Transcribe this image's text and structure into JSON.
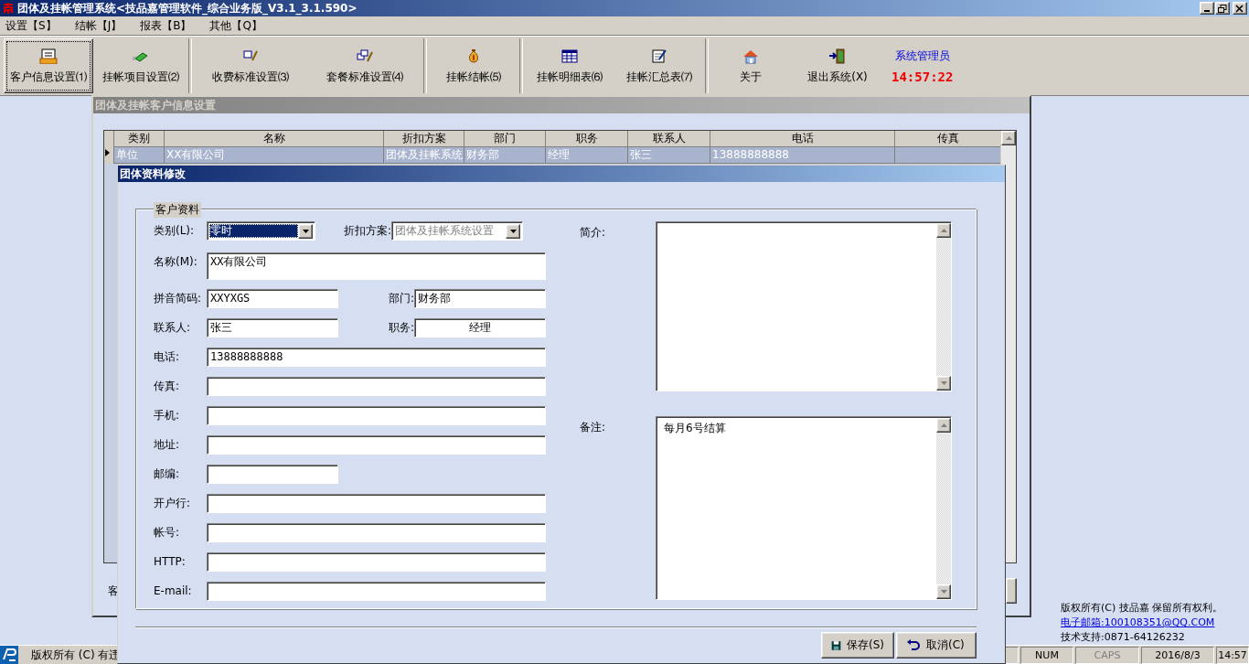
{
  "window": {
    "title": "团体及挂帐管理系统<技品嘉管理软件_综合业务版_V3.1_3.1.590>"
  },
  "menu": [
    "设置【S】",
    "结帐【J】",
    "报表【B】",
    "其他【Q】"
  ],
  "toolbar": [
    {
      "label": "客户信息设置⑴",
      "selected": true
    },
    {
      "label": "挂帐项目设置⑵",
      "selected": false
    },
    {
      "label": "收费标准设置⑶",
      "selected": false
    },
    {
      "label": "套餐标准设置⑷",
      "selected": false
    },
    {
      "label": "挂帐结帐⑸",
      "selected": false
    },
    {
      "label": "挂帐明细表⑹",
      "selected": false
    },
    {
      "label": "挂帐汇总表⑺",
      "selected": false
    },
    {
      "label": "关于",
      "selected": false
    },
    {
      "label": "退出系统(X)",
      "selected": false
    }
  ],
  "user": "系统管理员",
  "clock": "14:57:22",
  "child_window": {
    "title": "团体及挂帐客户信息设置",
    "table": {
      "columns": [
        "类别",
        "名称",
        "折扣方案",
        "部门",
        "职务",
        "联系人",
        "电话",
        "传真"
      ],
      "rows": [
        {
          "cells": [
            "单位",
            "XX有限公司",
            "团体及挂帐系统",
            "财务部",
            "经理",
            "张三",
            "13888888888",
            ""
          ],
          "selected": true
        }
      ]
    },
    "footer_label": "客"
  },
  "dialog": {
    "title": "团体资料修改",
    "group_title": "客户资料",
    "rows": [
      [
        {
          "kind": "combo",
          "label": "类别(L):",
          "value": "零时",
          "selected": true,
          "disabled": false
        },
        {
          "kind": "combo",
          "label": "折扣方案:",
          "value": "团体及挂帐系统设置",
          "selected": false,
          "disabled": true
        }
      ],
      [
        {
          "kind": "memo",
          "label": "名称(M):",
          "value": "XX有限公司"
        }
      ],
      [
        {
          "kind": "short",
          "label": "拼音简码:",
          "value": "XXYXGS"
        },
        {
          "kind": "short",
          "label": "部门:",
          "value": "财务部"
        }
      ],
      [
        {
          "kind": "short",
          "label": "联系人:",
          "value": "张三"
        },
        {
          "kind": "center",
          "label": "职务:",
          "value": "经理"
        }
      ],
      [
        {
          "kind": "text",
          "label": "电话:",
          "value": "13888888888"
        }
      ],
      [
        {
          "kind": "text",
          "label": "传真:"
        }
      ],
      [
        {
          "kind": "text",
          "label": "手机:"
        }
      ],
      [
        {
          "kind": "text",
          "label": "地址:"
        }
      ],
      [
        {
          "kind": "short",
          "label": "邮编:"
        }
      ],
      [
        {
          "kind": "text",
          "label": "开户行:"
        }
      ],
      [
        {
          "kind": "text",
          "label": "帐号:"
        }
      ],
      [
        {
          "kind": "text",
          "label": "HTTP:"
        }
      ],
      [
        {
          "kind": "text",
          "label": "E-mail:"
        }
      ]
    ],
    "notes": [
      {
        "label": "简介:"
      },
      {
        "label": "备注:",
        "value": "每月6号结算"
      }
    ],
    "buttons": [
      "保存(S)",
      "取消(C)"
    ]
  },
  "copyright": {
    "text": "版权所有(C) 技品嘉 保留所有权利。",
    "email": "电子邮箱:100108351@QQ.COM",
    "support": "技术支持:0871-64126232"
  },
  "status_bar": {
    "text": "版权所有 (C) 有违",
    "panels": [
      {
        "text": "NUM",
        "disabled": false
      },
      {
        "text": "CAPS",
        "disabled": true
      },
      {
        "text": "2016/8/3",
        "disabled": false
      },
      {
        "text": "14:57",
        "disabled": false
      }
    ]
  }
}
